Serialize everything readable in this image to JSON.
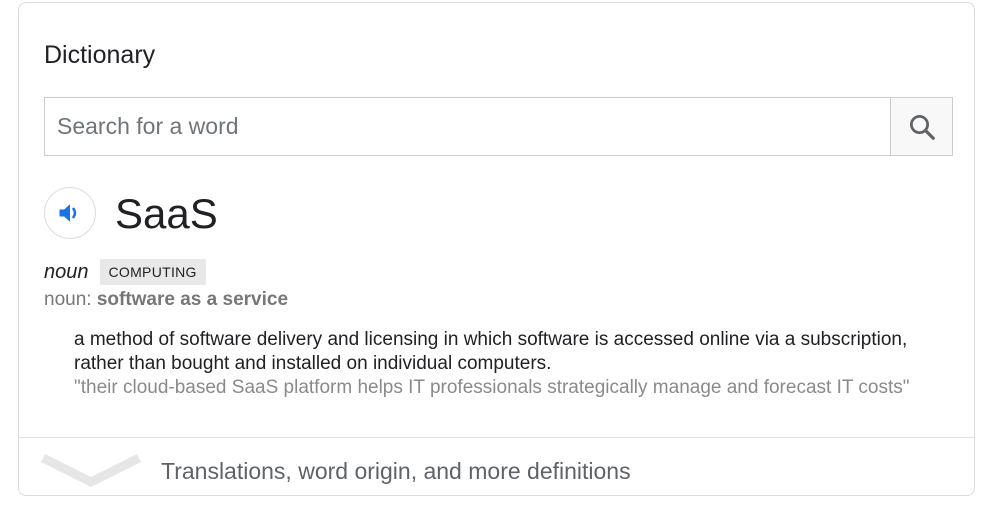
{
  "card": {
    "title": "Dictionary"
  },
  "search": {
    "placeholder": "Search for a word",
    "value": ""
  },
  "entry": {
    "word": "SaaS",
    "part_of_speech": "noun",
    "domain_tag": "COMPUTING",
    "abbreviation_prefix": "noun: ",
    "abbreviation_full": "software as a service",
    "definition": "a method of software delivery and licensing in which software is accessed online via a subscription, rather than bought and installed on individual computers.",
    "example": "\"their cloud-based SaaS platform helps IT professionals strategically manage and forecast IT costs\""
  },
  "footer": {
    "more_label": "Translations, word origin, and more definitions"
  },
  "icons": {
    "search": "search-icon",
    "speaker": "speaker-icon",
    "expand": "chevron-down-icon"
  },
  "colors": {
    "accent": "#1a73e8",
    "text": "#202124",
    "muted": "#777777"
  }
}
